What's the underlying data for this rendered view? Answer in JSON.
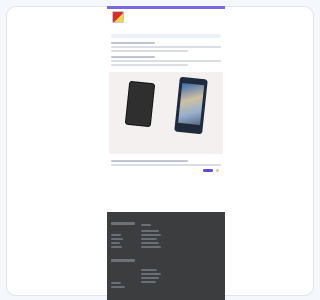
{
  "colors": {
    "accent": "#7d67dd",
    "pill": "#5d4bd0",
    "footer": "#3b3d3f"
  },
  "header": {
    "logo_icon": "logo-icon",
    "right_text": ""
  },
  "nav": {
    "items": [
      ""
    ]
  },
  "content": {
    "section_1": {
      "title": "",
      "meta": ""
    },
    "section_2": {
      "title": "",
      "meta": ""
    },
    "photo": {
      "icon": "phones-photo"
    },
    "caption": {
      "title": "",
      "meta": ""
    }
  },
  "footer": {
    "left_buttons": [
      "",
      ""
    ],
    "text": ""
  }
}
